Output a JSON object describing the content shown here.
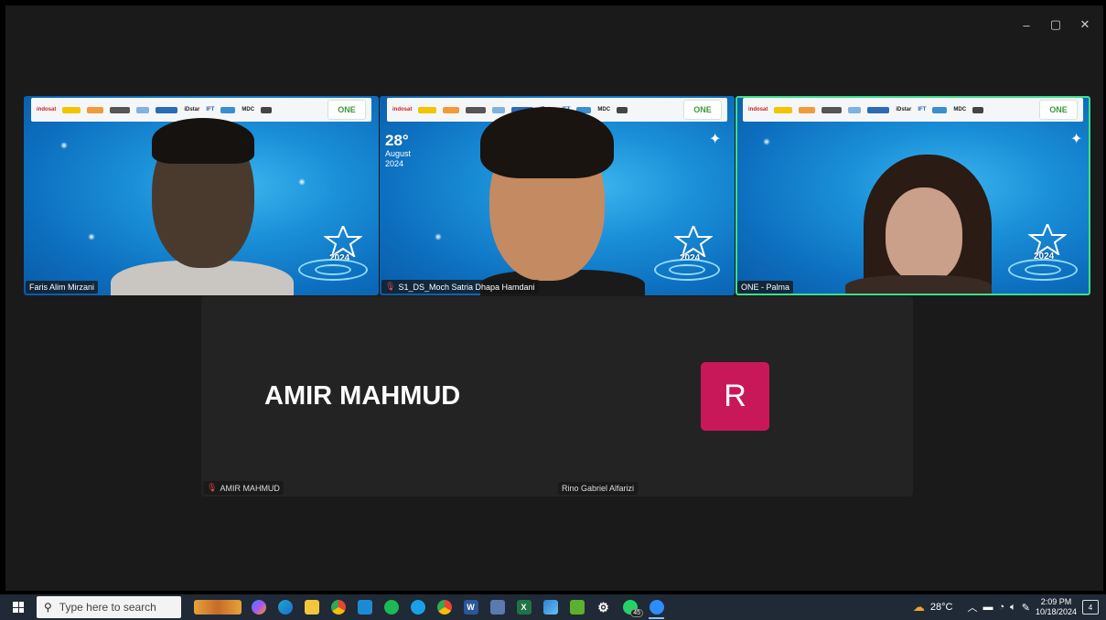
{
  "window": {
    "minimize": "–",
    "restore": "▢",
    "close": "✕"
  },
  "banner": {
    "brand": "ONE",
    "logos": [
      "indosat",
      "",
      "",
      "",
      "",
      "",
      "iDstar",
      "IFT",
      "",
      "MDC",
      ""
    ]
  },
  "event_year": "2024",
  "participants": [
    {
      "name": "Faris Alim Mirzani",
      "muted": false
    },
    {
      "name": "S1_DS_Moch Satria Dhapa Hamdani",
      "muted": true,
      "date": {
        "day": "28°",
        "month": "August",
        "year": "2024"
      }
    },
    {
      "name": "ONE - Palma",
      "muted": false,
      "active_speaker": true
    }
  ],
  "bottom_tile": {
    "display_name": "AMIR MAHMUD",
    "left_label": "AMIR MAHMUD",
    "avatar_letter": "R",
    "right_label": "Rino Gabriel Alfarizi"
  },
  "taskbar": {
    "search_placeholder": "Type here to search",
    "whatsapp_badge": "45",
    "weather": "28°C",
    "time": "2:09 PM",
    "date": "10/18/2024",
    "notifications": "4",
    "colors": {
      "bar": "#1f2a36",
      "active_indicator": "#7fc4ff"
    }
  },
  "colors": {
    "active_border": "#3be08a",
    "avatar": "#c9185a",
    "muted_mic": "#e04848"
  }
}
